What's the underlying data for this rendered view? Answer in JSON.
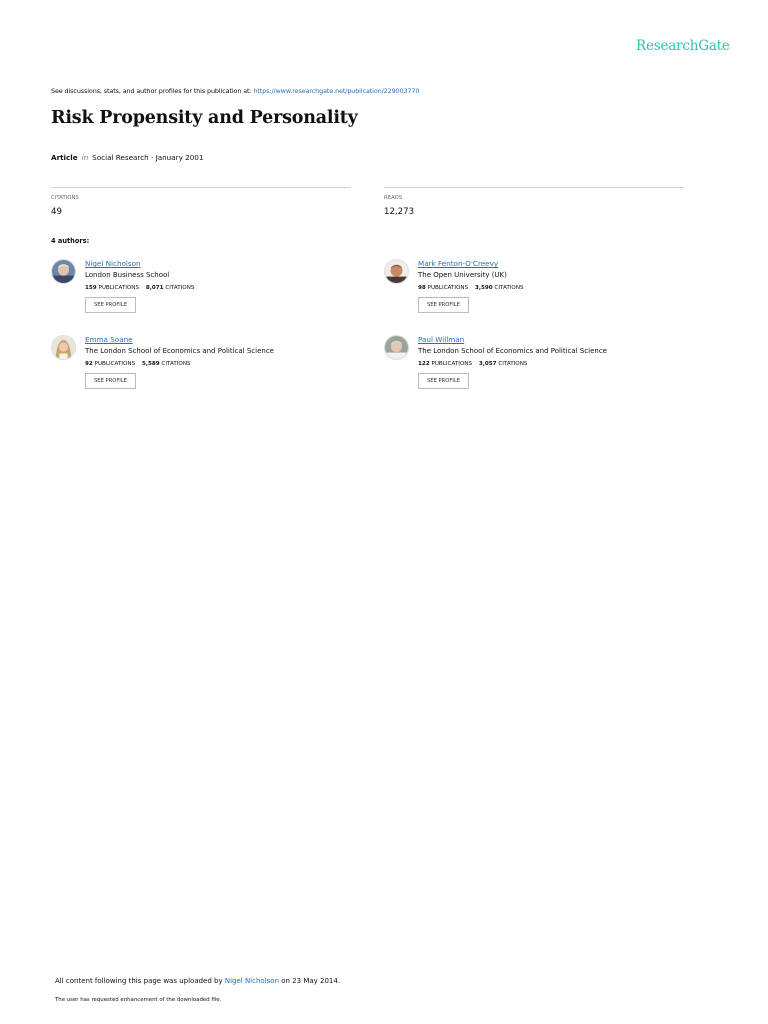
{
  "brand": {
    "logo_text": "ResearchGate"
  },
  "header": {
    "discuss_text": "See discussions, stats, and author profiles for this publication at: ",
    "discuss_link": "https://www.researchgate.net/publication/229003770"
  },
  "publication": {
    "title": "Risk Propensity and Personality",
    "type": "Article",
    "in_word": "in",
    "venue": "Social Research · January 2001"
  },
  "stats": {
    "citations_label": "CITATIONS",
    "citations_value": "49",
    "reads_label": "READS",
    "reads_value": "12,273"
  },
  "authors_heading": "4 authors:",
  "authors": [
    {
      "name": "Nigel Nicholson",
      "institution": "London Business School",
      "publications": "159",
      "citations": "8,071",
      "publications_label": "PUBLICATIONS",
      "citations_label": "CITATIONS",
      "button": "SEE PROFILE"
    },
    {
      "name": "Mark Fenton-O'Creevy",
      "institution": "The Open University (UK)",
      "publications": "98",
      "citations": "3,590",
      "publications_label": "PUBLICATIONS",
      "citations_label": "CITATIONS",
      "button": "SEE PROFILE"
    },
    {
      "name": "Emma Soane",
      "institution": "The London School of Economics and Political Science",
      "publications": "92",
      "citations": "5,589",
      "publications_label": "PUBLICATIONS",
      "citations_label": "CITATIONS",
      "button": "SEE PROFILE"
    },
    {
      "name": "Paul Willman",
      "institution": "The London School of Economics and Political Science",
      "publications": "122",
      "citations": "3,057",
      "publications_label": "PUBLICATIONS",
      "citations_label": "CITATIONS",
      "button": "SEE PROFILE"
    }
  ],
  "footer": {
    "upload_prefix": "All content following this page was uploaded by ",
    "upload_user": "Nigel Nicholson",
    "upload_suffix": " on 23 May 2014.",
    "note": "The user has requested enhancement of the downloaded file."
  },
  "colors": {
    "brand": "#2bc4a9",
    "link": "#2a6fb5"
  }
}
